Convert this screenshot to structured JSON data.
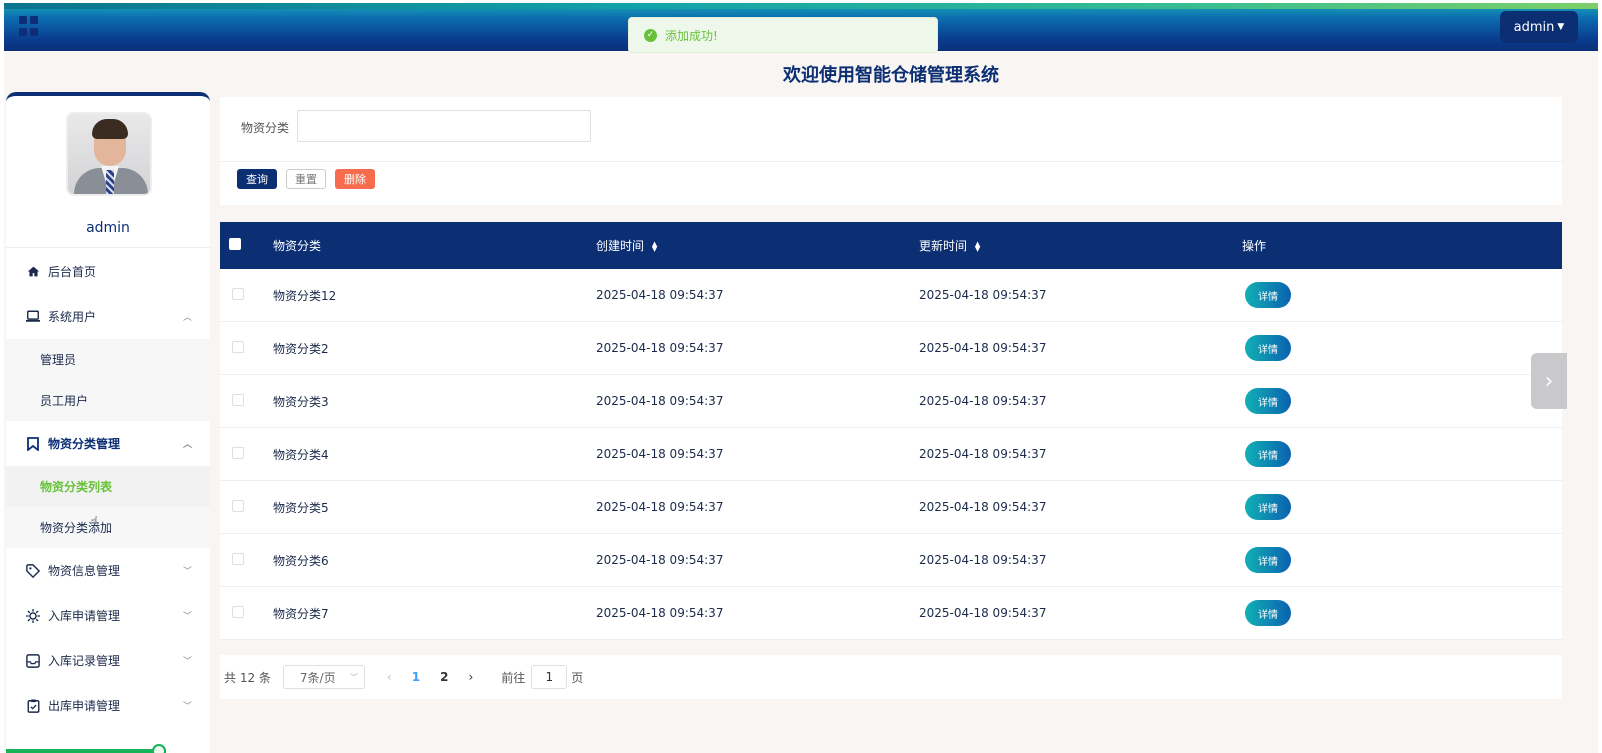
{
  "header": {
    "user_label": "admin",
    "toast": "添加成功!"
  },
  "page_title": "欢迎使用智能仓储管理系统",
  "sidebar": {
    "username": "admin",
    "menu": [
      {
        "label": "后台首页"
      },
      {
        "label": "系统用户",
        "children": [
          "管理员",
          "员工用户"
        ]
      },
      {
        "label": "物资分类管理",
        "children": [
          "物资分类列表",
          "物资分类添加"
        ]
      },
      {
        "label": "物资信息管理"
      },
      {
        "label": "入库申请管理"
      },
      {
        "label": "入库记录管理"
      },
      {
        "label": "出库申请管理"
      }
    ]
  },
  "search": {
    "label": "物资分类",
    "input_value": "",
    "query_label": "查询",
    "reset_label": "重置",
    "delete_label": "删除"
  },
  "table": {
    "columns": [
      "物资分类",
      "创建时间",
      "更新时间",
      "操作"
    ],
    "detail_label": "详情",
    "rows": [
      {
        "name": "物资分类12",
        "created": "2025-04-18 09:54:37",
        "updated": "2025-04-18 09:54:37"
      },
      {
        "name": "物资分类2",
        "created": "2025-04-18 09:54:37",
        "updated": "2025-04-18 09:54:37"
      },
      {
        "name": "物资分类3",
        "created": "2025-04-18 09:54:37",
        "updated": "2025-04-18 09:54:37"
      },
      {
        "name": "物资分类4",
        "created": "2025-04-18 09:54:37",
        "updated": "2025-04-18 09:54:37"
      },
      {
        "name": "物资分类5",
        "created": "2025-04-18 09:54:37",
        "updated": "2025-04-18 09:54:37"
      },
      {
        "name": "物资分类6",
        "created": "2025-04-18 09:54:37",
        "updated": "2025-04-18 09:54:37"
      },
      {
        "name": "物资分类7",
        "created": "2025-04-18 09:54:37",
        "updated": "2025-04-18 09:54:37"
      }
    ]
  },
  "pagination": {
    "total": "共 12 条",
    "page_size": "7条/页",
    "pages": [
      "1",
      "2"
    ],
    "goto_label": "前往",
    "goto_value": "1",
    "page_unit": "页"
  },
  "colors": {
    "brand": "#0c2f74",
    "success": "#67c23a",
    "danger": "#f56c4e",
    "pager_active": "#409eff"
  },
  "icons": {
    "header_menu": "grid-icon",
    "home": "home-icon",
    "users": "laptop-icon",
    "category": "bookmark-icon",
    "info": "tag-icon",
    "inbound_apply": "sun-icon",
    "inbound_record": "inbox-icon",
    "outbound_apply": "clipboard-icon"
  }
}
